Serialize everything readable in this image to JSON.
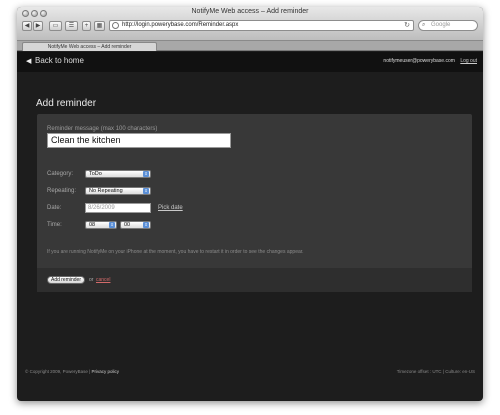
{
  "browser": {
    "window_title": "NotifyMe Web access – Add reminder",
    "url": "http://login.powerybase.com/Reminder.aspx",
    "search_placeholder": "Google",
    "tab_title": "NotifyMe Web access – Add reminder",
    "reload_glyph": "↻",
    "back_glyph": "◀",
    "forward_glyph": "▶",
    "add_glyph": "+"
  },
  "header": {
    "back_label": "Back to home",
    "user_email": "notifymeuser@powerybase.com",
    "logout_label": "Log out"
  },
  "page": {
    "title": "Add reminder"
  },
  "form": {
    "message_label": "Reminder message (max 100 characters)",
    "message_value": "Clean the kitchen",
    "category_label": "Category:",
    "category_value": "ToDo",
    "repeating_label": "Repeating:",
    "repeating_value": "No Repeating",
    "date_label": "Date:",
    "date_value": "8/26/2009",
    "pick_date_label": "Pick date",
    "time_label": "Time:",
    "hour_value": "08",
    "minute_value": "00",
    "info_text": "If you are running NotifyMe on your iPhone at the moment, you have to restart it in order to see the changes appear.",
    "add_button": "Add reminder",
    "or_text": "or",
    "cancel_label": "cancel"
  },
  "footer": {
    "copyright": "© Copyright 2009, PoweryBase | ",
    "privacy": "Privacy policy",
    "locale": "Timezone offset : UTC | Culture: en-US"
  },
  "colors": {
    "background": "#1d1d1d",
    "panel": "#383838",
    "cancel_link": "#d26a6a"
  }
}
